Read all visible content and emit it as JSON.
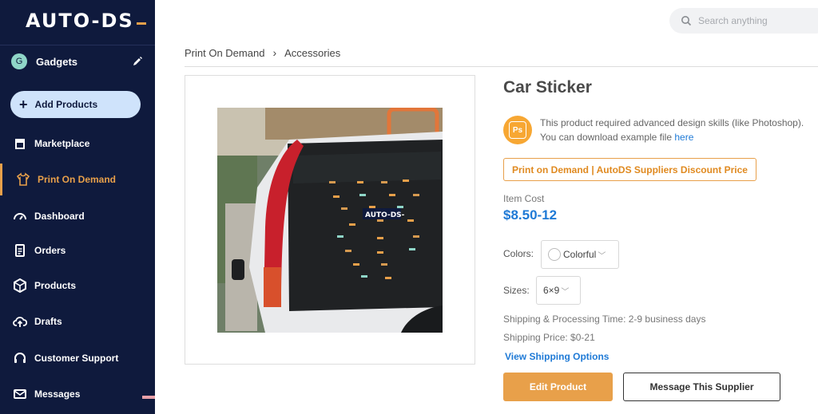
{
  "sidebar": {
    "logo_text": "AUTO-DS",
    "store": {
      "initial": "G",
      "name": "Gadgets"
    },
    "add_products_label": "Add Products",
    "items": [
      {
        "label": "Marketplace",
        "icon": "store-icon"
      },
      {
        "label": "Print On Demand",
        "icon": "shirt-icon",
        "active": true
      },
      {
        "label": "Dashboard",
        "icon": "gauge-icon"
      },
      {
        "label": "Orders",
        "icon": "clipboard-icon"
      },
      {
        "label": "Products",
        "icon": "box-icon"
      },
      {
        "label": "Drafts",
        "icon": "cloud-upload-icon"
      },
      {
        "label": "Customer Support",
        "icon": "headset-icon"
      },
      {
        "label": "Messages",
        "icon": "mail-icon"
      }
    ]
  },
  "search": {
    "placeholder": "Search anything"
  },
  "breadcrumb": {
    "parent": "Print On Demand",
    "current": "Accessories"
  },
  "product": {
    "title": "Car Sticker",
    "ps_label": "Ps",
    "notice_line1": "This product required advanced design skills (like Photoshop).",
    "notice_line2": "You can download example file",
    "notice_link": "here",
    "tag": "Print on Demand | AutoDS Suppliers Discount Price",
    "cost_label": "Item Cost",
    "cost_value": "$8.50-12",
    "colors_label": "Colors:",
    "colors_value": "Colorful",
    "sizes_label": "Sizes:",
    "sizes_value": "6×9",
    "shipping_time": "Shipping & Processing Time: 2-9 business days",
    "shipping_price": "Shipping Price: $0-21",
    "shipping_link": "View Shipping Options",
    "edit_button": "Edit Product",
    "message_button": "Message This Supplier",
    "sticker_text": "AUTO-DS-"
  },
  "colors": {
    "sidebar_bg": "#0f1a3d",
    "accent": "#e8a04a",
    "link": "#1f7ad6"
  }
}
